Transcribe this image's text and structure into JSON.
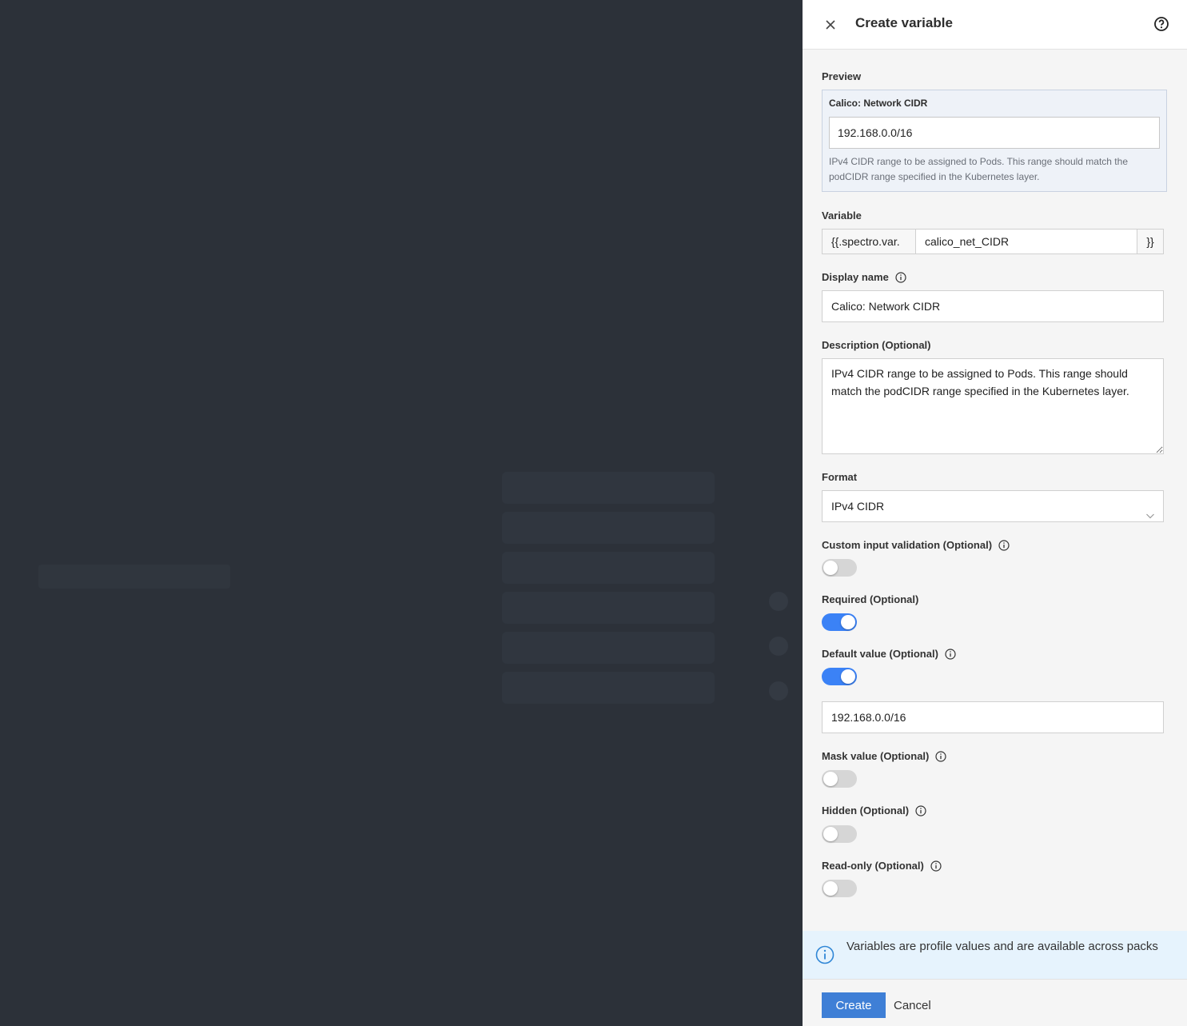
{
  "drawer": {
    "title": "Create variable"
  },
  "preview": {
    "section_label": "Preview",
    "field_label": "Calico: Network CIDR",
    "value": "192.168.0.0/16",
    "help": "IPv4 CIDR range to be assigned to Pods. This range should match the podCIDR range specified in the Kubernetes layer."
  },
  "variable": {
    "label": "Variable",
    "prefix": "{{.spectro.var.",
    "name": "calico_net_CIDR",
    "suffix": "}}"
  },
  "display_name": {
    "label": "Display name",
    "value": "Calico: Network CIDR"
  },
  "description": {
    "label": "Description (Optional)",
    "value": "IPv4 CIDR range to be assigned to Pods. This range should match the podCIDR range specified in the Kubernetes layer."
  },
  "format": {
    "label": "Format",
    "selected": "IPv4 CIDR"
  },
  "custom_validation": {
    "label": "Custom input validation (Optional)",
    "enabled": false
  },
  "required": {
    "label": "Required (Optional)",
    "enabled": true
  },
  "default_value": {
    "label": "Default value (Optional)",
    "enabled": true,
    "value": "192.168.0.0/16"
  },
  "mask_value": {
    "label": "Mask value (Optional)",
    "enabled": false
  },
  "hidden": {
    "label": "Hidden (Optional)",
    "enabled": false
  },
  "read_only": {
    "label": "Read-only (Optional)",
    "enabled": false
  },
  "banner": {
    "text": "Variables are profile values and are available across packs"
  },
  "footer": {
    "create_label": "Create",
    "cancel_label": "Cancel"
  },
  "colors": {
    "accent": "#3f7fd6",
    "toggle_on": "#3b82f6",
    "banner_bg": "#e6f3fd",
    "preview_bg": "#eef2f8"
  }
}
